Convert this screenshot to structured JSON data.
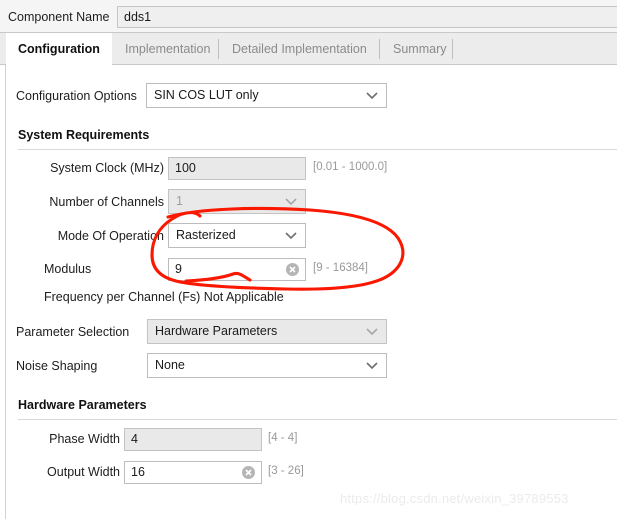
{
  "component": {
    "label": "Component Name",
    "value": "dds1"
  },
  "tabs": [
    {
      "label": "Configuration",
      "active": true
    },
    {
      "label": "Implementation",
      "active": false
    },
    {
      "label": "Detailed Implementation",
      "active": false
    },
    {
      "label": "Summary",
      "active": false
    }
  ],
  "config_options": {
    "label": "Configuration Options",
    "value": "SIN COS LUT only"
  },
  "sections": {
    "system_requirements": "System Requirements",
    "hardware_parameters": "Hardware Parameters"
  },
  "fields": {
    "system_clock": {
      "label": "System Clock (MHz)",
      "value": "100",
      "range": "[0.01 - 1000.0]"
    },
    "number_of_channels": {
      "label": "Number of Channels",
      "value": "1"
    },
    "mode_of_operation": {
      "label": "Mode Of Operation",
      "value": "Rasterized"
    },
    "modulus": {
      "label": "Modulus",
      "value": "9",
      "range": "[9 - 16384]"
    },
    "frequency_per_channel": {
      "text": "Frequency per Channel (Fs) Not Applicable"
    },
    "parameter_selection": {
      "label": "Parameter Selection",
      "value": "Hardware Parameters"
    },
    "noise_shaping": {
      "label": "Noise Shaping",
      "value": "None"
    },
    "phase_width": {
      "label": "Phase Width",
      "value": "4",
      "range": "[4 - 4]"
    },
    "output_width": {
      "label": "Output Width",
      "value": "16",
      "range": "[3 - 26]"
    }
  },
  "icons": {
    "clear": "clear-circle-icon",
    "chevron": "chevron-down-icon"
  },
  "annotation": {
    "color": "#fb1800",
    "shape": "hand-drawn-red-ellipse"
  },
  "watermark": {
    "text": "https://blog.csdn.net/weixin_39789553"
  }
}
